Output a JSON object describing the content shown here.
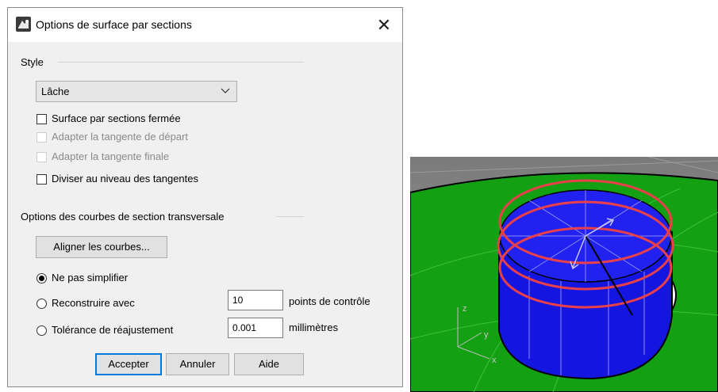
{
  "dialog": {
    "title": "Options de surface par sections",
    "close_glyph": "✕",
    "style_group": {
      "label": "Style",
      "selected": "Lâche",
      "checkboxes": [
        {
          "label": "Surface par sections fermée",
          "checked": false,
          "enabled": true
        },
        {
          "label": "Adapter la tangente de départ",
          "checked": false,
          "enabled": false
        },
        {
          "label": "Adapter la tangente finale",
          "checked": false,
          "enabled": false
        },
        {
          "label": "Diviser au niveau des tangentes",
          "checked": false,
          "enabled": true
        }
      ]
    },
    "curves_group": {
      "label": "Options des courbes de section transversale",
      "align_button": "Aligner les courbes...",
      "radios": [
        {
          "label": "Ne pas simplifier",
          "selected": true
        },
        {
          "label": "Reconstruire avec",
          "selected": false,
          "value": "10",
          "unit": "points de contrôle"
        },
        {
          "label": "Tolérance de réajustement",
          "selected": false,
          "value": "0.001",
          "unit": "millimètres"
        }
      ]
    },
    "buttons": {
      "ok": "Accepter",
      "cancel": "Annuler",
      "help": "Aide"
    }
  },
  "viewport": {
    "axis_labels": {
      "x": "x",
      "y": "y",
      "z": "z"
    },
    "colors": {
      "surface": "#12a012",
      "loft": "#1a1ae8",
      "curves": "#e8404a",
      "background": "#8a8a8a"
    }
  }
}
